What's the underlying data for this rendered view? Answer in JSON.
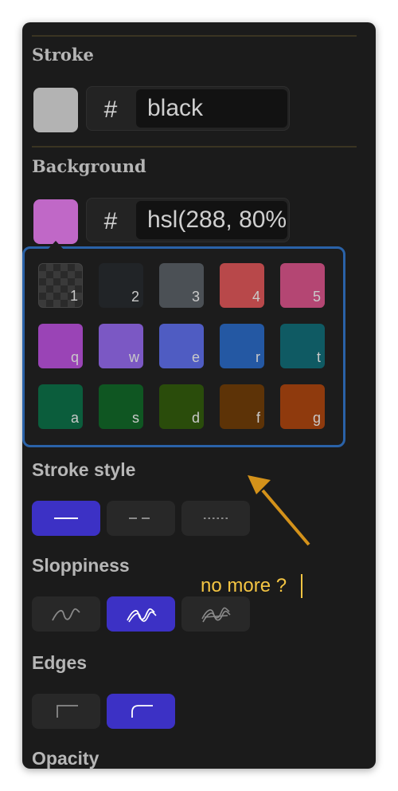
{
  "stroke": {
    "title": "Stroke",
    "swatch_color": "#b3b3b3",
    "hash": "#",
    "value": "black"
  },
  "background": {
    "title": "Background",
    "swatch_color": "#c068c7",
    "hash": "#",
    "value": "hsl(288, 80%"
  },
  "palette": {
    "rows": [
      [
        {
          "key": "1",
          "color": "transparent"
        },
        {
          "key": "2",
          "color": "#212427"
        },
        {
          "key": "3",
          "color": "#4b5055"
        },
        {
          "key": "4",
          "color": "#b8484a"
        },
        {
          "key": "5",
          "color": "#b44673"
        }
      ],
      [
        {
          "key": "q",
          "color": "#9a44b6"
        },
        {
          "key": "w",
          "color": "#7b58c4"
        },
        {
          "key": "e",
          "color": "#4f5cc2"
        },
        {
          "key": "r",
          "color": "#2458a3"
        },
        {
          "key": "t",
          "color": "#0f5a63"
        }
      ],
      [
        {
          "key": "a",
          "color": "#0b5d3c"
        },
        {
          "key": "s",
          "color": "#0f5622"
        },
        {
          "key": "d",
          "color": "#2a4c0b"
        },
        {
          "key": "f",
          "color": "#5d3307"
        },
        {
          "key": "g",
          "color": "#8f3a0d"
        }
      ]
    ]
  },
  "stroke_style": {
    "title": "Stroke style",
    "options": [
      {
        "name": "solid",
        "active": true
      },
      {
        "name": "dashed",
        "active": false
      },
      {
        "name": "dotted",
        "active": false
      }
    ]
  },
  "sloppiness": {
    "title": "Sloppiness",
    "options": [
      {
        "name": "architect",
        "active": false
      },
      {
        "name": "artist",
        "active": true
      },
      {
        "name": "cartoonist",
        "active": false
      }
    ]
  },
  "edges": {
    "title": "Edges",
    "options": [
      {
        "name": "sharp",
        "active": false
      },
      {
        "name": "round",
        "active": true
      }
    ]
  },
  "opacity": {
    "title": "Opacity"
  },
  "annotation": {
    "text": "no more ?",
    "color": "#f4c543"
  },
  "colors": {
    "panel_bg": "#1b1b1b",
    "accent": "#3c31c5",
    "picker_border": "#2a62a8"
  }
}
